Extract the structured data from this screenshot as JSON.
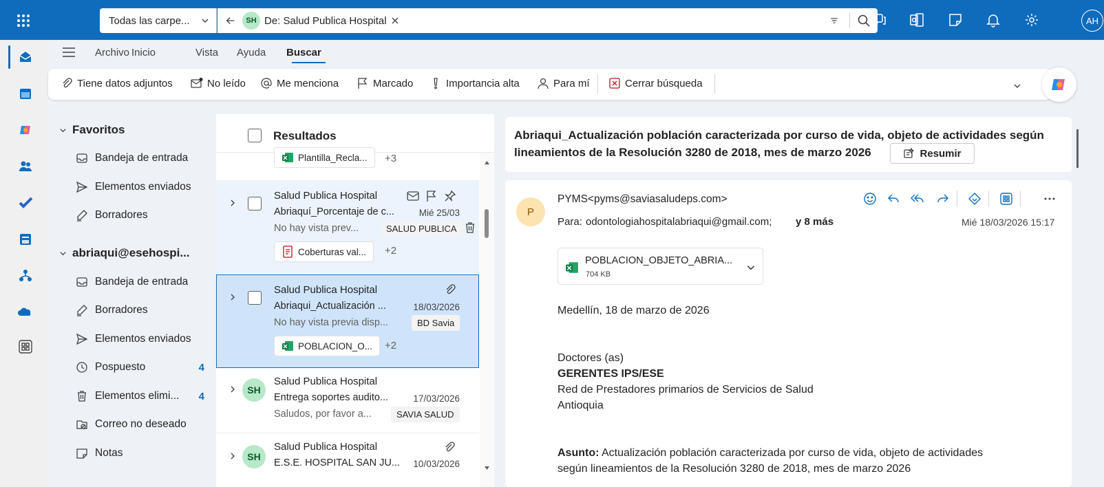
{
  "header": {
    "folder_select": "Todas las carpe...",
    "chip_initials": "SH",
    "chip_label": "De: Salud Publica Hospital",
    "avatar_initials": "AH"
  },
  "menu": {
    "items": [
      "Archivo",
      "Inicio",
      "Vista",
      "Ayuda",
      "Buscar"
    ],
    "active": "Buscar"
  },
  "filters": {
    "attachments": "Tiene datos adjuntos",
    "unread": "No leído",
    "mentions": "Me menciona",
    "flagged": "Marcado",
    "importance": "Importancia alta",
    "to_me": "Para mí",
    "close": "Cerrar búsqueda"
  },
  "folders": {
    "favorites_header": "Favoritos",
    "favorites": [
      {
        "label": "Bandeja de entrada",
        "icon": "inbox-icon"
      },
      {
        "label": "Elementos enviados",
        "icon": "send-icon"
      },
      {
        "label": "Borradores",
        "icon": "draft-icon"
      }
    ],
    "account_header": "abriaqui@esehospi...",
    "account": [
      {
        "label": "Bandeja de entrada",
        "icon": "inbox-icon",
        "count": ""
      },
      {
        "label": "Borradores",
        "icon": "draft-icon",
        "count": ""
      },
      {
        "label": "Elementos enviados",
        "icon": "send-icon",
        "count": ""
      },
      {
        "label": "Pospuesto",
        "icon": "clock-icon",
        "count": "4"
      },
      {
        "label": "Elementos elimi...",
        "icon": "trash-icon",
        "count": "4"
      },
      {
        "label": "Correo no deseado",
        "icon": "junk-icon",
        "count": ""
      },
      {
        "label": "Notas",
        "icon": "note-icon",
        "count": ""
      }
    ]
  },
  "list": {
    "header": "Resultados",
    "top_partial": {
      "attachment": "Plantilla_Recla...",
      "more": "+3"
    },
    "items": [
      {
        "sender": "Salud Publica Hospital",
        "subject": "Abriaquí_Porcentaje de c...",
        "date": "Mié 25/03",
        "preview": "No hay vista prev...",
        "tag": "SALUD PUBLICA",
        "attachment": "Coberturas val...",
        "more": "+2"
      },
      {
        "sender": "Salud Publica Hospital",
        "subject": "Abriaqui_Actualización ...",
        "date": "18/03/2026",
        "preview": "No hay vista previa disp...",
        "tag": "BD Savia",
        "attachment": "POBLACION_O...",
        "more": "+2"
      },
      {
        "initials": "SH",
        "sender": "Salud Publica Hospital",
        "subject": "Entrega soportes audito...",
        "date": "17/03/2026",
        "preview": "Saludos, por favor a...",
        "tag": "SAVIA SALUD"
      },
      {
        "initials": "SH",
        "sender": "Salud Publica Hospital",
        "subject": "E.S.E. HOSPITAL SAN JU...",
        "date": "10/03/2026"
      }
    ]
  },
  "reading": {
    "subject_line1": "Abriaqui_Actualización población caracterizada por curso de vida, objeto de actividades según",
    "subject_line2": "lineamientos de la Resolución 3280 de 2018, mes de marzo 2026",
    "summarize": "Resumir",
    "sender_initial": "P",
    "from": "PYMS<pyms@saviasaludeps.com>",
    "to_label": "Para:",
    "to": "odontologiahospitalabriaqui@gmail.com;",
    "more_recipients": "y 8 más",
    "date": "Mié 18/03/2026 15:17",
    "attachment_name": "POBLACION_OBJETO_ABRIA...",
    "attachment_size": "704 KB",
    "body": {
      "place_date": "Medellín, 18 de marzo de 2026",
      "l1": "Doctores (as)",
      "l2": "GERENTES IPS/ESE",
      "l3": "Red de Prestadores primarios de Servicios de Salud",
      "l4": "Antioquia",
      "asunto_label": "Asunto:",
      "asunto_1": " Actualización población caracterizada por curso de vida, objeto de actividades",
      "asunto_2": "según lineamientos de la Resolución 3280 de 2018, mes de marzo 2026"
    }
  },
  "colors": {
    "brand": "#0f6cbd",
    "selected_row": "#cfe4fa",
    "hover_row": "#ebf3fc",
    "avatar_green": "#b7e8c7",
    "avatar_peach": "#fce3b0"
  }
}
